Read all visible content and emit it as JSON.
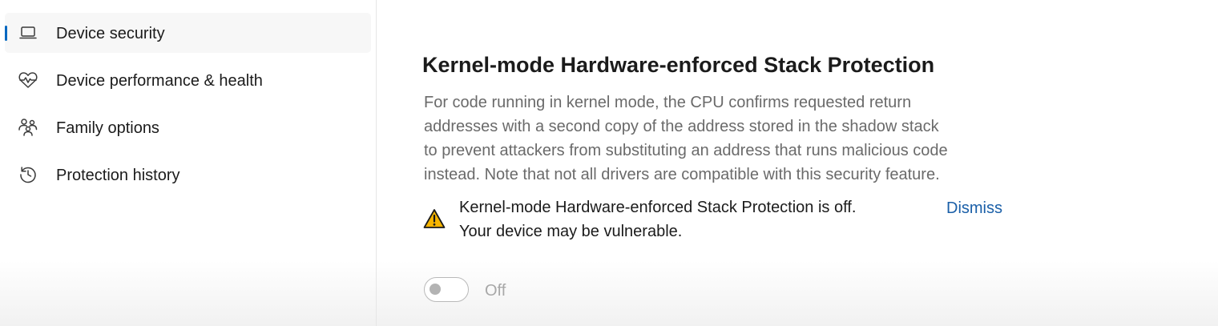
{
  "sidebar": {
    "items": [
      {
        "label": "Device security",
        "icon": "laptop-icon",
        "selected": true
      },
      {
        "label": "Device performance & health",
        "icon": "heart-pulse-icon",
        "selected": false
      },
      {
        "label": "Family options",
        "icon": "family-icon",
        "selected": false
      },
      {
        "label": "Protection history",
        "icon": "history-icon",
        "selected": false
      }
    ]
  },
  "main": {
    "title": "Kernel-mode Hardware-enforced Stack Protection",
    "description_lines": [
      "For code running in kernel mode, the CPU confirms requested return",
      "addresses with a second copy of the address stored in the shadow stack",
      "to prevent attackers from substituting an address that runs malicious code",
      "instead. Note that not all drivers are compatible with this security feature."
    ],
    "warning": {
      "icon": "warning-icon",
      "lines": [
        "Kernel-mode Hardware-enforced Stack Protection is off.",
        "Your device may be vulnerable."
      ],
      "dismiss_label": "Dismiss"
    },
    "toggle": {
      "state": "off",
      "label": "Off"
    }
  },
  "colors": {
    "accent": "#0067c0",
    "link": "#1a5fa8",
    "warning_fill": "#f7b500"
  }
}
